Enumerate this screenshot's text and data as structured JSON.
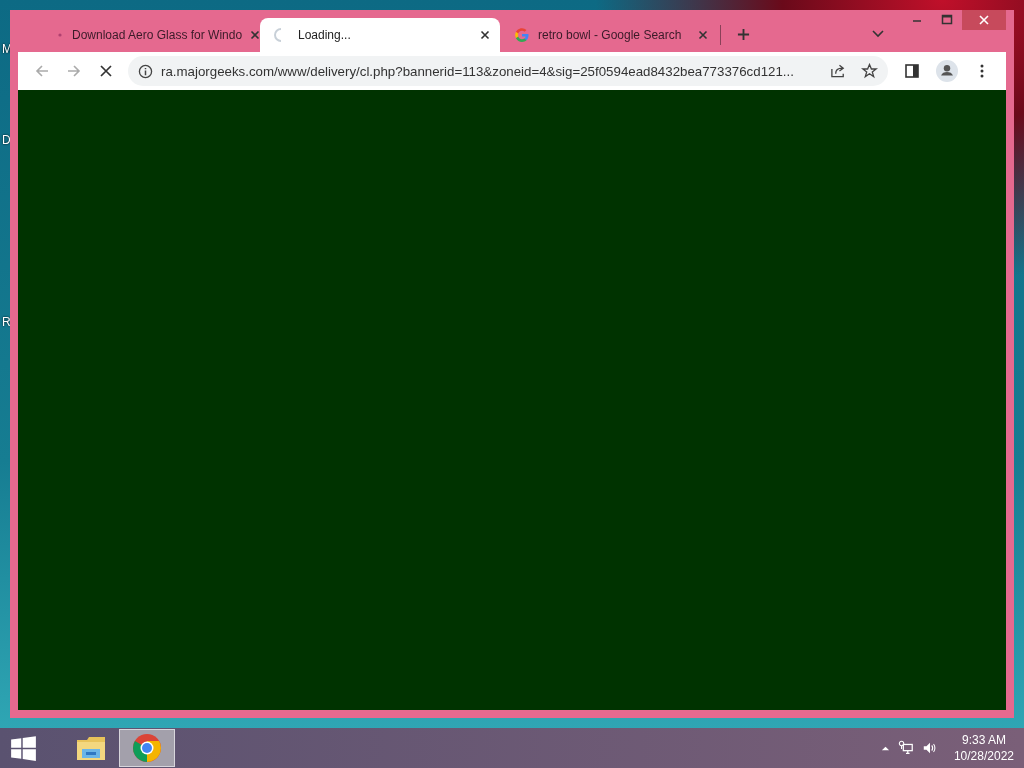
{
  "desktop": {
    "icon_labels": [
      "M",
      "D",
      "R"
    ]
  },
  "browser": {
    "tabs": [
      {
        "title": "Download Aero Glass for Windo",
        "selected": false,
        "kind": "page"
      },
      {
        "title": "Loading...",
        "selected": true,
        "kind": "loading"
      },
      {
        "title": "retro bowl - Google Search",
        "selected": false,
        "kind": "google"
      }
    ],
    "address": {
      "url": "ra.majorgeeks.com/www/delivery/cl.php?bannerid=113&zoneid=4&sig=25f0594ead8432bea773376cd121..."
    },
    "loading": true
  },
  "taskbar": {
    "apps": [
      {
        "kind": "explorer",
        "selected": false
      },
      {
        "kind": "chrome",
        "selected": true
      }
    ],
    "time": "9:33 AM",
    "date": "10/28/2022"
  }
}
